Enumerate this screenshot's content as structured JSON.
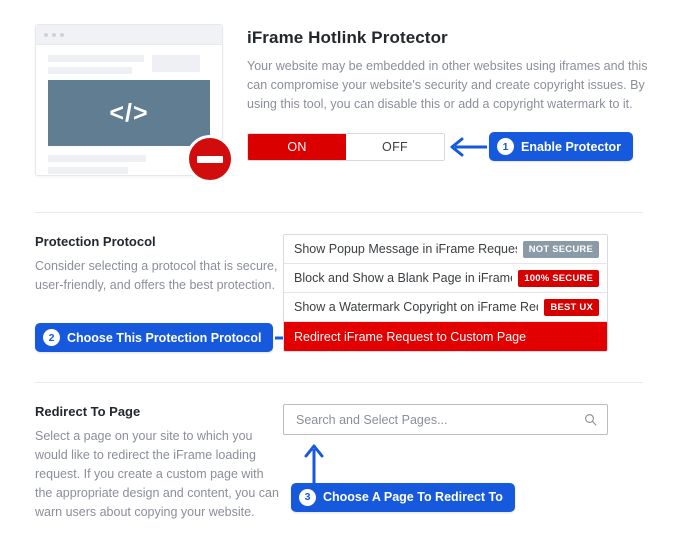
{
  "hero": {
    "title": "iFrame Hotlink Protector",
    "description": "Your website may be embedded in other websites using iframes and this can compromise your website's security and create copyright issues. By using this tool, you can disable this or add a copyright watermark to it.",
    "illustration": {
      "code_glyph": "</>",
      "icon_name": "no-entry-icon"
    },
    "toggle": {
      "on_label": "ON",
      "off_label": "OFF",
      "selected": "ON"
    },
    "callout": {
      "number": "1",
      "label": "Enable Protector",
      "arrow": "arrow-left-icon"
    }
  },
  "protocol": {
    "title": "Protection Protocol",
    "description": "Consider selecting a protocol that is secure, user-friendly, and offers the best protection.",
    "options": [
      {
        "label": "Show Popup Message in iFrame Requests",
        "tag": "NOT SECURE",
        "tag_style": "gray",
        "selected": false
      },
      {
        "label": "Block and Show a Blank Page in iFrames",
        "tag": "100% SECURE",
        "tag_style": "red",
        "selected": false
      },
      {
        "label": "Show a Watermark Copyright on iFrame Requests",
        "tag": "BEST UX",
        "tag_style": "red",
        "selected": false
      },
      {
        "label": "Redirect iFrame Request to Custom Page",
        "tag": "",
        "tag_style": "",
        "selected": true
      }
    ],
    "callout": {
      "number": "2",
      "label": "Choose This Protection Protocol",
      "arrow": "arrow-right-icon"
    }
  },
  "redirect": {
    "title": "Redirect To Page",
    "description": "Select a page on your site to which you would like to redirect the iFrame loading request. If you create a custom page with the appropriate design and content, you can warn users about copying your website.",
    "search": {
      "placeholder": "Search and Select Pages...",
      "value": "",
      "icon": "search-icon"
    },
    "callout": {
      "number": "3",
      "label": "Choose A Page To Redirect To",
      "arrow": "arrow-up-icon"
    }
  },
  "colors": {
    "accent_blue": "#1659dd",
    "danger_red": "#db0000",
    "selected_red": "#e30000",
    "tag_gray": "#8a9aa6",
    "illustration_panel": "#607d92",
    "muted_text": "#8a8f98"
  }
}
